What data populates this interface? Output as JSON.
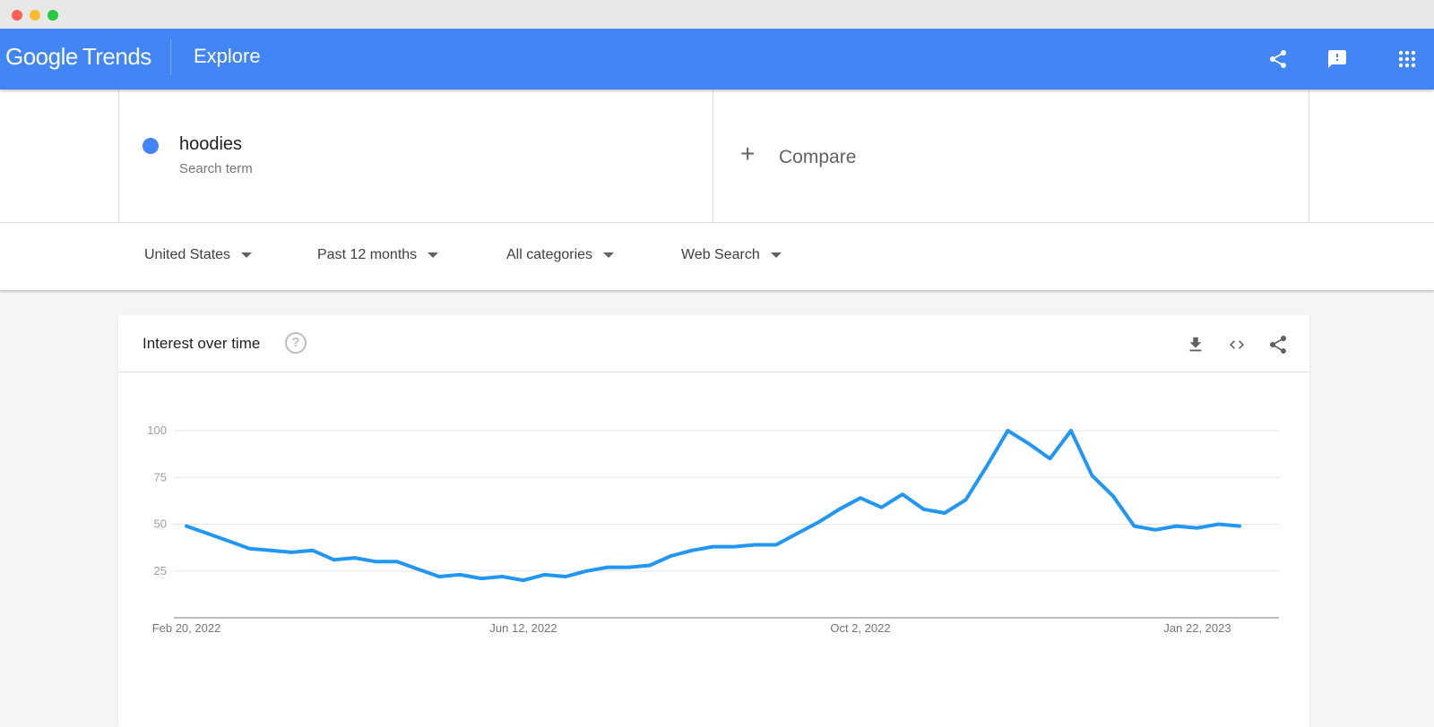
{
  "window": {
    "controls": [
      "close",
      "minimize",
      "maximize"
    ]
  },
  "appbar": {
    "logo_google": "Google",
    "logo_trends": "Trends",
    "page_title": "Explore",
    "icons": [
      "share-icon",
      "feedback-icon",
      "apps-grid-icon"
    ]
  },
  "search": {
    "term": "hoodies",
    "term_type": "Search term",
    "term_color": "#4285f4",
    "compare_label": "Compare"
  },
  "filters": [
    {
      "label": "United States"
    },
    {
      "label": "Past 12 months"
    },
    {
      "label": "All categories"
    },
    {
      "label": "Web Search"
    }
  ],
  "card": {
    "title": "Interest over time",
    "help": "?",
    "actions": [
      "download-icon",
      "embed-icon",
      "share-icon"
    ]
  },
  "chart_data": {
    "type": "line",
    "title": "Interest over time",
    "xlabel": "",
    "ylabel": "",
    "ylim": [
      0,
      100
    ],
    "yticks": [
      25,
      50,
      75,
      100
    ],
    "xtick_labels": [
      "Feb 20, 2022",
      "Jun 12, 2022",
      "Oct 2, 2022",
      "Jan 22, 2023"
    ],
    "xtick_indices": [
      0,
      16,
      32,
      48
    ],
    "grid": true,
    "legend": "none",
    "series": [
      {
        "name": "hoodies",
        "color": "#2196f3",
        "values": [
          49,
          45,
          41,
          37,
          36,
          35,
          36,
          31,
          32,
          30,
          30,
          26,
          22,
          23,
          21,
          22,
          20,
          23,
          22,
          25,
          27,
          27,
          28,
          33,
          36,
          38,
          38,
          39,
          39,
          45,
          51,
          58,
          64,
          59,
          66,
          58,
          56,
          63,
          81,
          100,
          93,
          85,
          100,
          76,
          65,
          49,
          47,
          49,
          48,
          50,
          49
        ]
      }
    ]
  }
}
